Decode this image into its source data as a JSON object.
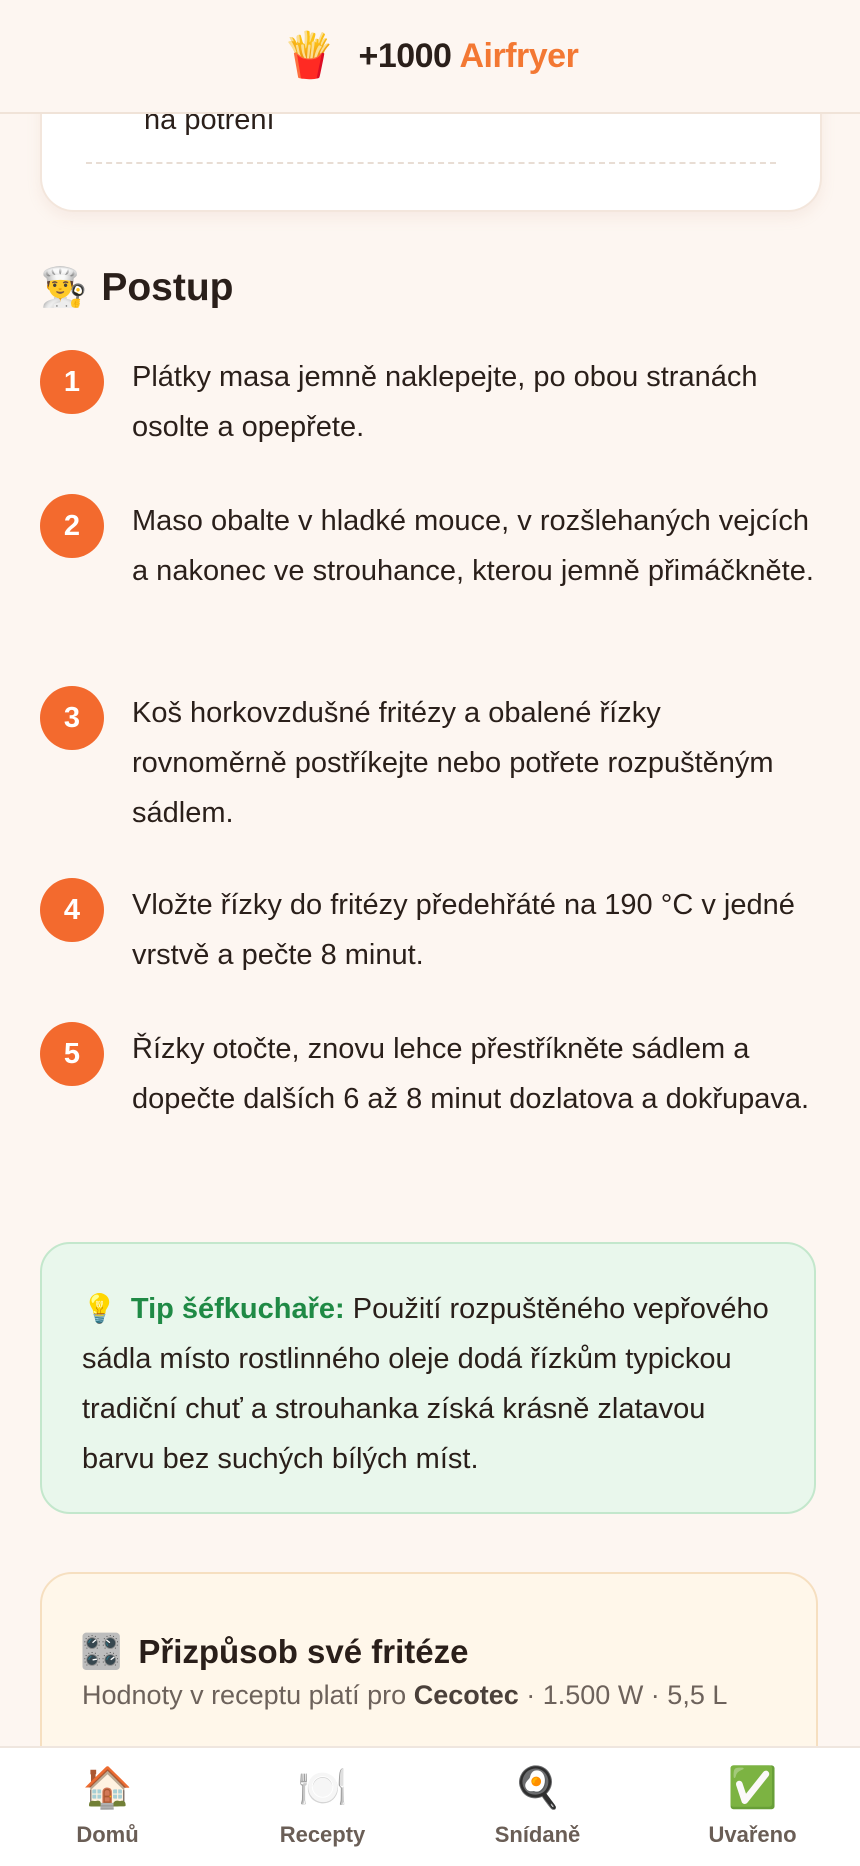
{
  "header": {
    "logo_icon": "🍟",
    "brand_count": "+1000",
    "brand_name": "Airfryer",
    "accent_color": "#f37833"
  },
  "ingredients_card": {
    "visible_text": "na potření"
  },
  "procedure": {
    "icon": "👨‍🍳",
    "title": "Postup",
    "steps": [
      {
        "num": "1",
        "text": "Plátky masa jemně naklepejte, po obou stranách osolte a opepřete."
      },
      {
        "num": "2",
        "text": "Maso obalte v hladké mouce, v rozšlehaných vejcích a nakonec ve strouhance, kterou jemně přimáčkněte."
      },
      {
        "num": "3",
        "text": "Koš horkovzdušné fritézy a obalené řízky rovnoměrně postříkejte nebo potřete rozpuštěným sádlem."
      },
      {
        "num": "4",
        "text": "Vložte řízky do fritézy předehřáté na 190 °C v jedné vrstvě a pečte 8 minut."
      },
      {
        "num": "5",
        "text": "Řízky otočte, znovu lehce přestříkněte sádlem a dopečte dalších 6 až 8 minut dozlatova a dokřupava."
      }
    ]
  },
  "tip": {
    "icon": "💡",
    "title": "Tip šéfkuchaře:",
    "text": "Použití rozpuštěného vepřového sádla místo rostlinného oleje dodá řízkům typickou tradiční chuť a strouhanka získá krásně zlatavou barvu bez suchých bílých míst."
  },
  "customize": {
    "icon": "🎛️",
    "title": "Přizpůsob své fritéze",
    "desc_prefix": "Hodnoty v receptu platí pro",
    "brand": "Cecotec",
    "specs": "· 1.500 W · 5,5 L"
  },
  "bottom_nav": {
    "items": [
      {
        "icon": "🏠",
        "label": "Domů"
      },
      {
        "icon": "🍽️",
        "label": "Recepty"
      },
      {
        "icon": "🍳",
        "label": "Snídaně"
      },
      {
        "icon": "✅",
        "label": "Uvařeno"
      }
    ]
  }
}
